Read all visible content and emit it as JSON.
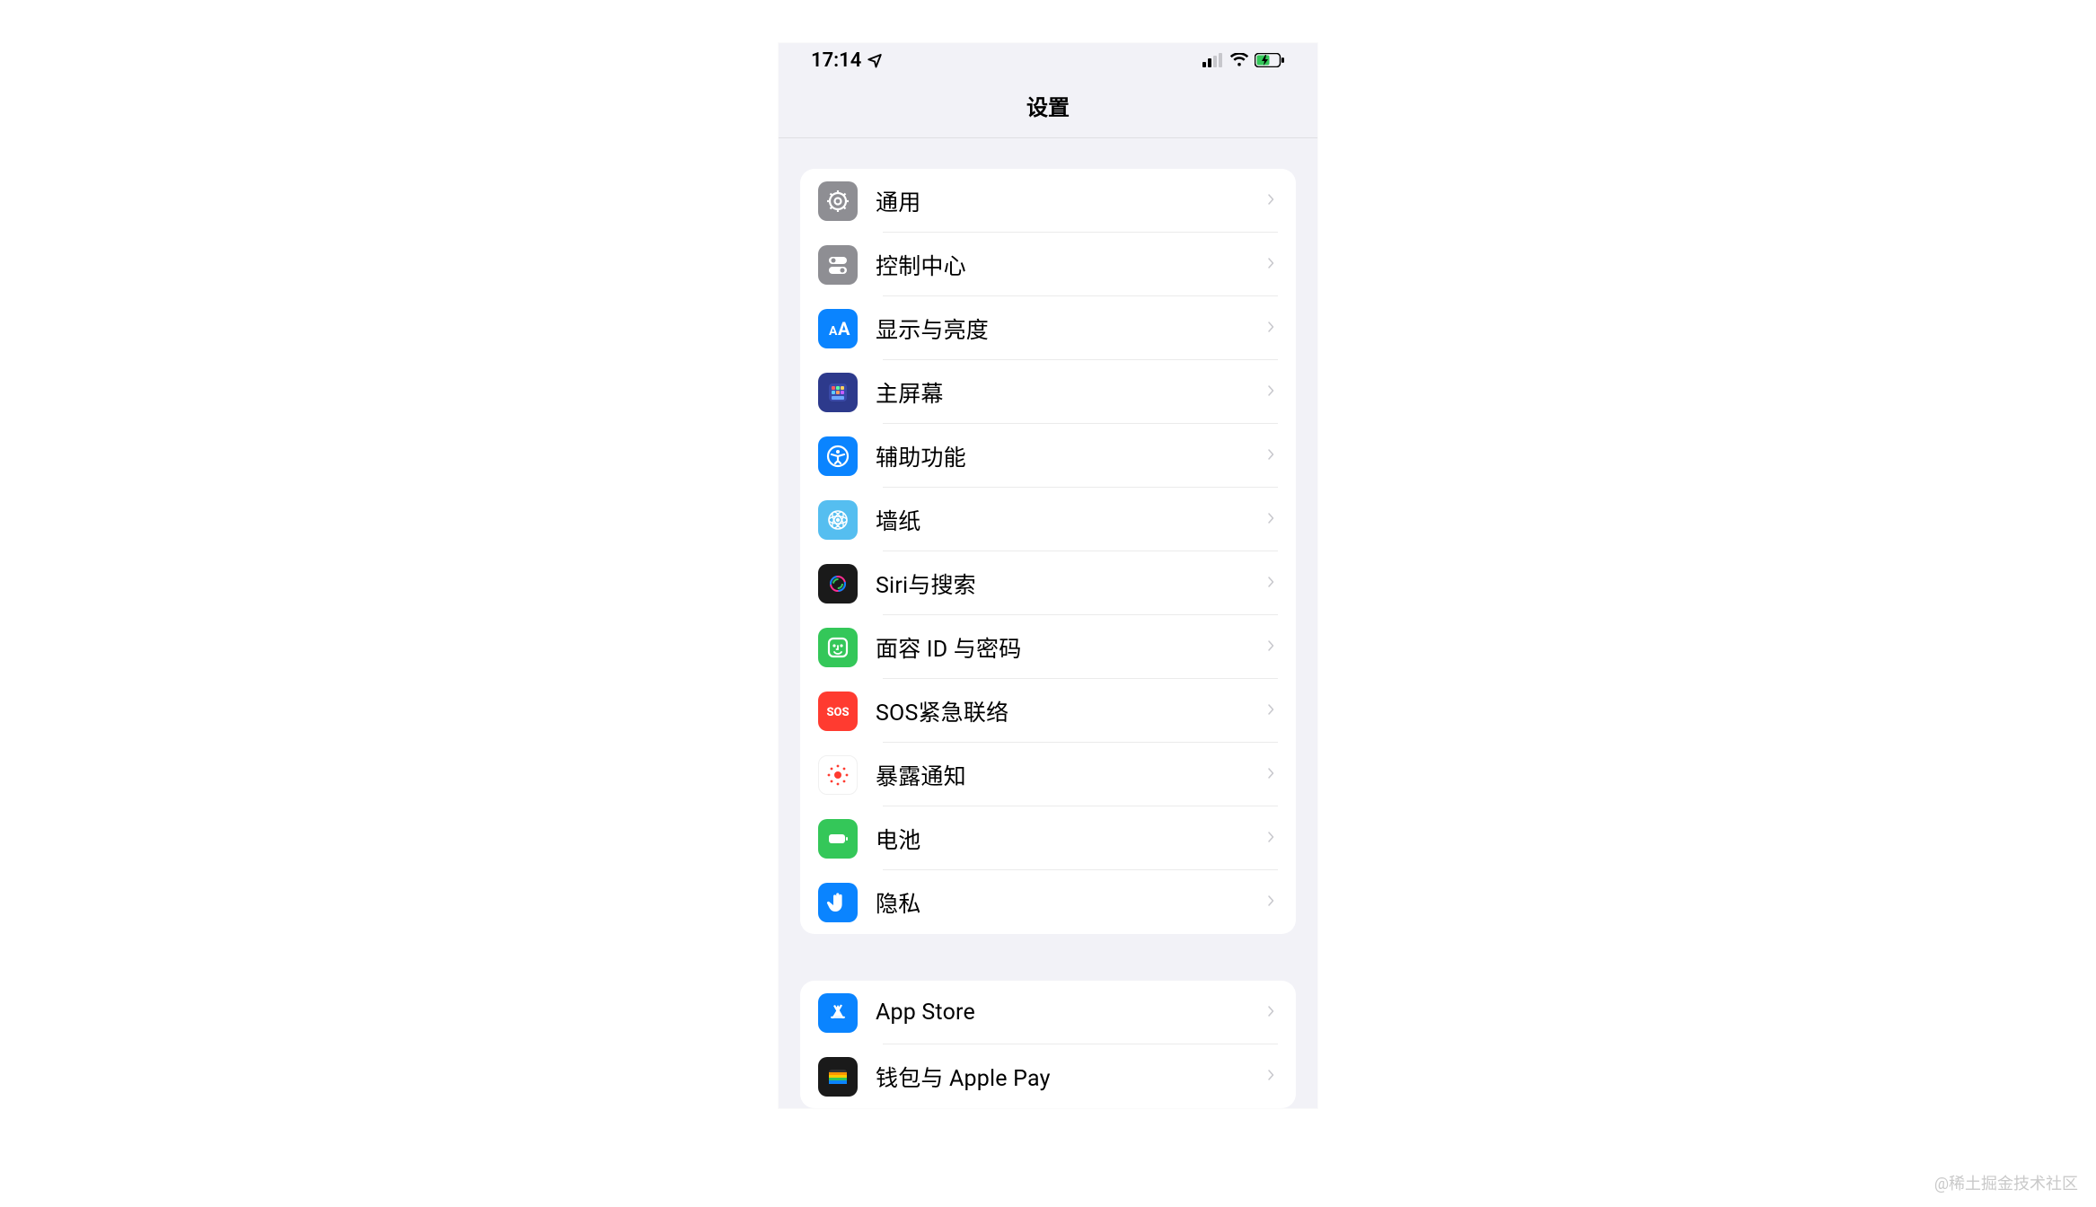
{
  "status": {
    "time": "17:14"
  },
  "header": {
    "title": "设置"
  },
  "sections": [
    {
      "items": [
        {
          "id": "general",
          "label": "通用",
          "icon": "gear-icon",
          "bg": "#8e8e93",
          "fg": "#ffffff"
        },
        {
          "id": "control-center",
          "label": "控制中心",
          "icon": "toggles-icon",
          "bg": "#8e8e93",
          "fg": "#ffffff"
        },
        {
          "id": "display",
          "label": "显示与亮度",
          "icon": "text-size-icon",
          "bg": "#0a84ff",
          "fg": "#ffffff"
        },
        {
          "id": "home-screen",
          "label": "主屏幕",
          "icon": "home-grid-icon",
          "bg": "#2d3a8c",
          "fg": "#ffffff"
        },
        {
          "id": "accessibility",
          "label": "辅助功能",
          "icon": "accessibility-icon",
          "bg": "#0a84ff",
          "fg": "#ffffff"
        },
        {
          "id": "wallpaper",
          "label": "墙纸",
          "icon": "wallpaper-icon",
          "bg": "#55bef0",
          "fg": "#ffffff"
        },
        {
          "id": "siri",
          "label": "Siri与搜索",
          "icon": "siri-icon",
          "bg": "#1a1a1a",
          "fg": "#ffffff"
        },
        {
          "id": "faceid",
          "label": "面容 ID 与密码",
          "icon": "faceid-icon",
          "bg": "#34c759",
          "fg": "#ffffff"
        },
        {
          "id": "sos",
          "label": "SOS紧急联络",
          "icon": "sos-icon",
          "bg": "#ff3b30",
          "fg": "#ffffff"
        },
        {
          "id": "exposure",
          "label": "暴露通知",
          "icon": "exposure-icon",
          "bg": "#ffffff",
          "fg": "#ff3b30"
        },
        {
          "id": "battery",
          "label": "电池",
          "icon": "battery-icon",
          "bg": "#34c759",
          "fg": "#ffffff"
        },
        {
          "id": "privacy",
          "label": "隐私",
          "icon": "hand-icon",
          "bg": "#0a84ff",
          "fg": "#ffffff"
        }
      ]
    },
    {
      "items": [
        {
          "id": "app-store",
          "label": "App Store",
          "icon": "appstore-icon",
          "bg": "#0a84ff",
          "fg": "#ffffff"
        },
        {
          "id": "wallet",
          "label": "钱包与 Apple Pay",
          "icon": "wallet-icon",
          "bg": "#1a1a1a",
          "fg": "#ffffff"
        }
      ]
    }
  ],
  "watermark": "@稀土掘金技术社区"
}
